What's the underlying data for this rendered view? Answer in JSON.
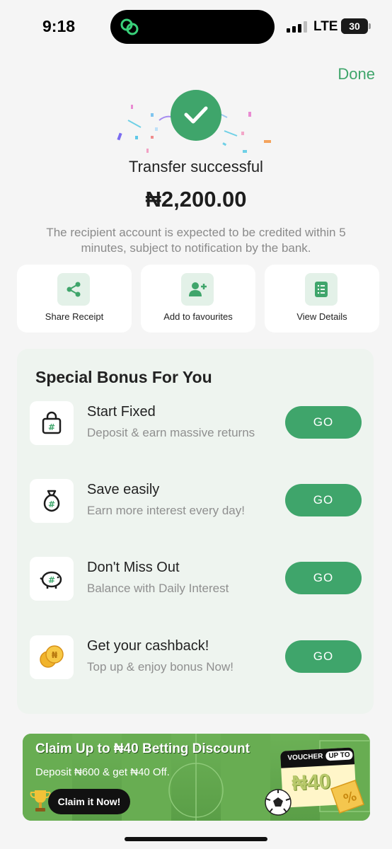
{
  "status_bar": {
    "time": "9:18",
    "network": "LTE",
    "battery": "30"
  },
  "header": {
    "done_label": "Done"
  },
  "hero": {
    "title": "Transfer successful",
    "amount": "₦2,200.00",
    "note": "The recipient account is expected to be credited within 5 minutes, subject to notification by the bank."
  },
  "actions": [
    {
      "label": "Share Receipt",
      "icon": "share-icon"
    },
    {
      "label": "Add to favourites",
      "icon": "add-user-icon"
    },
    {
      "label": "View Details",
      "icon": "document-list-icon"
    }
  ],
  "bonus": {
    "title": "Special Bonus For You",
    "items": [
      {
        "name": "Start Fixed",
        "desc": "Deposit & earn massive returns",
        "button": "GO",
        "icon": "lock-bag-icon"
      },
      {
        "name": "Save easily",
        "desc": "Earn more interest every day!",
        "button": "GO",
        "icon": "money-bag-icon"
      },
      {
        "name": "Don't Miss Out",
        "desc": "Balance with Daily Interest",
        "button": "GO",
        "icon": "piggy-bank-icon"
      },
      {
        "name": "Get your cashback!",
        "desc": "Top up & enjoy bonus Now!",
        "button": "GO",
        "icon": "coins-icon"
      }
    ]
  },
  "banner": {
    "title": "Claim Up to ₦40 Betting Discount",
    "subtitle": "Deposit ₦600 & get ₦40 Off.",
    "button": "Claim it Now!",
    "voucher_label": "VOUCHER",
    "voucher_upto": "UP TO",
    "voucher_amount": "₦40"
  },
  "colors": {
    "accent": "#3fa56b",
    "icon_bg": "#e3f1e8",
    "panel_bg": "#eef4ef",
    "background": "#f5f5f5"
  }
}
